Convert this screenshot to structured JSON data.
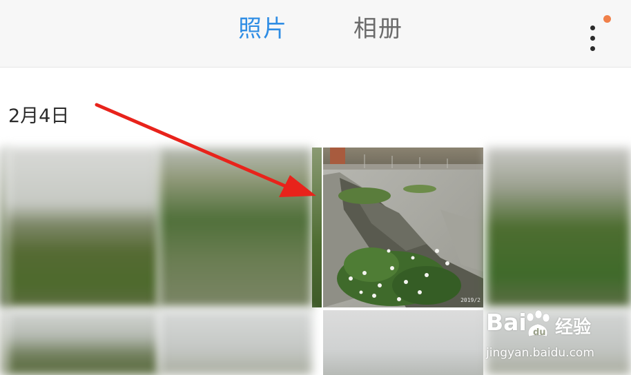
{
  "header": {
    "tabs": [
      {
        "label": "照片",
        "active": true
      },
      {
        "label": "相册",
        "active": false
      }
    ],
    "more_icon": "more-vertical-icon",
    "notification_color": "#f0804a",
    "active_color": "#2f8de4"
  },
  "gallery": {
    "section_date": "2月4日",
    "photo_stamp": "2019/2"
  },
  "watermark": {
    "brand_latin": "Bai",
    "brand_cn": "经验",
    "url": "jingyan.baidu.com"
  },
  "annotation": {
    "arrow_color": "#e8231b"
  }
}
